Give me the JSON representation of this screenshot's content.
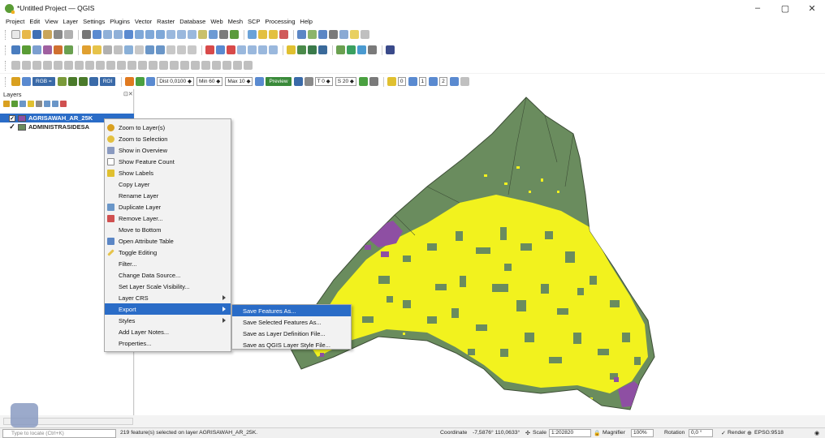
{
  "window": {
    "title": "*Untitled Project — QGIS",
    "minimize": "–",
    "maximize": "▢",
    "close": "✕"
  },
  "menu": [
    "Project",
    "Edit",
    "View",
    "Layer",
    "Settings",
    "Plugins",
    "Vector",
    "Raster",
    "Database",
    "Web",
    "Mesh",
    "SCP",
    "Processing",
    "Help"
  ],
  "scp_toolbar": {
    "rgb_label": "RGB =",
    "roi_label": "ROI",
    "dist_label": "Dist",
    "dist_value": "0,0100",
    "min_label": "Min",
    "min_value": "60",
    "max_label": "Max",
    "max_value": "10",
    "preview_label": "Preview",
    "t_label": "T",
    "t_value": "0",
    "s_label": "S",
    "s_value": "20",
    "band1": "1",
    "band2": "2",
    "band3": "0"
  },
  "layers_panel": {
    "title": "Layers",
    "close": "⊡✕",
    "layers": [
      {
        "name": "AGRISAWAH_AR_25K",
        "checked": "✓",
        "color": "#8e4fa3",
        "selected": true
      },
      {
        "name": "ADMINISTRASIDESA",
        "checked": "✓",
        "color": "#6a8c5e",
        "selected": false
      }
    ]
  },
  "context_menu": {
    "items": [
      {
        "label": "Zoom to Layer(s)",
        "icon": "zoom-layer-icon"
      },
      {
        "label": "Zoom to Selection",
        "icon": "zoom-selection-icon"
      },
      {
        "label": "Show in Overview",
        "icon": "overview-icon"
      },
      {
        "label": "Show Feature Count",
        "icon": "checkbox-icon"
      },
      {
        "label": "Show Labels",
        "icon": "labels-icon"
      },
      {
        "label": "Copy Layer",
        "icon": ""
      },
      {
        "label": "Rename Layer",
        "icon": ""
      },
      {
        "label": "Duplicate Layer",
        "icon": "duplicate-icon"
      },
      {
        "label": "Remove Layer...",
        "icon": "remove-icon"
      },
      {
        "label": "Move to Bottom",
        "icon": ""
      },
      {
        "label": "Open Attribute Table",
        "icon": "table-icon"
      },
      {
        "label": "Toggle Editing",
        "icon": "pencil-icon"
      },
      {
        "label": "Filter...",
        "icon": ""
      },
      {
        "label": "Change Data Source...",
        "icon": ""
      },
      {
        "label": "Set Layer Scale Visibility...",
        "icon": ""
      },
      {
        "label": "Layer CRS",
        "icon": "",
        "submenu": true
      },
      {
        "label": "Export",
        "icon": "",
        "submenu": true,
        "highlighted": true
      },
      {
        "label": "Styles",
        "icon": "",
        "submenu": true
      },
      {
        "label": "Add Layer Notes...",
        "icon": ""
      },
      {
        "label": "Properties...",
        "icon": ""
      }
    ]
  },
  "export_submenu": {
    "items": [
      {
        "label": "Save Features As...",
        "highlighted": true
      },
      {
        "label": "Save Selected Features As..."
      },
      {
        "label": "Save as Layer Definition File..."
      },
      {
        "label": "Save as QGIS Layer Style File..."
      }
    ]
  },
  "status": {
    "locate_placeholder": "Type to locate (Ctrl+K)",
    "message": "219 feature(s) selected on layer AGRISAWAH_AR_25K.",
    "coordinate_label": "Coordinate",
    "coordinate": "-7,5876° 110,0633°",
    "scale_label": "Scale",
    "scale": "1:202820",
    "magnifier_label": "Magnifier",
    "magnifier": "100%",
    "rotation_label": "Rotation",
    "rotation": "0,0 °",
    "render_label": "Render",
    "crs": "EPSG:9518"
  },
  "colors": {
    "selection_blue": "#2a6cc7",
    "admin_green": "#6a8c5e",
    "sawah_yellow": "#f2f21e",
    "sawah_purple": "#8e4fa3"
  }
}
